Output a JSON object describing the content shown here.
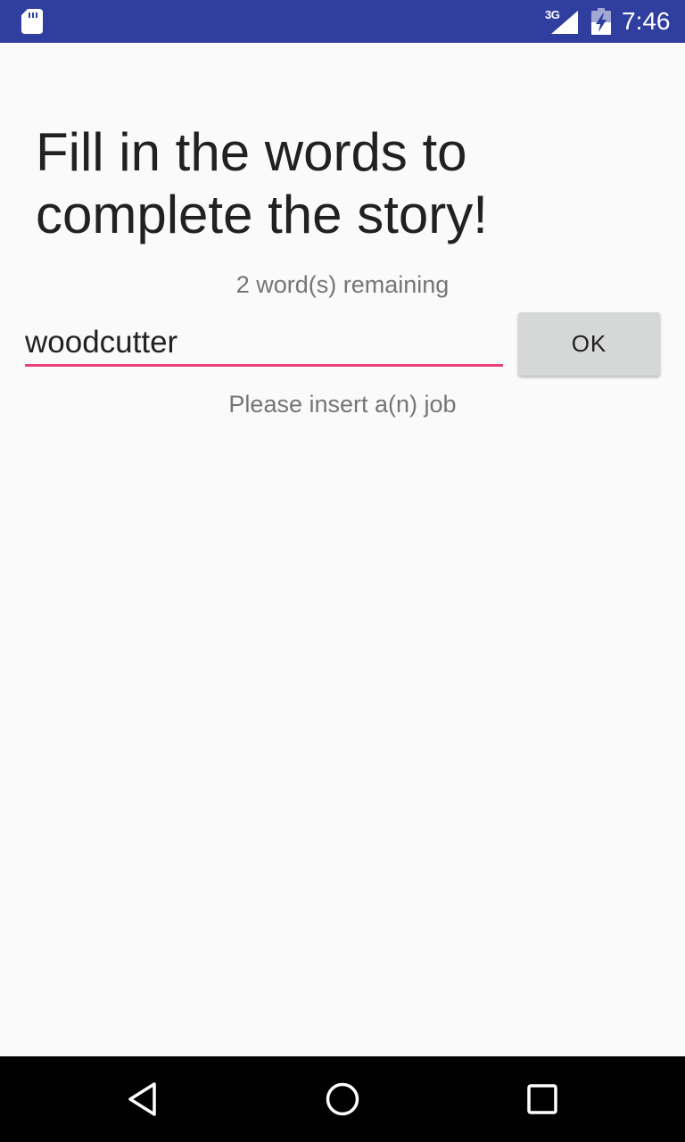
{
  "status_bar": {
    "network": "3G",
    "time": "7:46",
    "icons": [
      "sd-card-icon",
      "signal-icon",
      "battery-charging-icon"
    ],
    "bg_color": "#303f9f"
  },
  "main": {
    "title": "Fill in the words to complete the story!",
    "remaining_text": "2 word(s) remaining",
    "input_value": "woodcutter",
    "ok_label": "OK",
    "hint_text": "Please insert a(n) job",
    "accent_color": "#ec407a"
  },
  "nav_bar": {
    "icons": [
      "back-icon",
      "home-icon",
      "recents-icon"
    ]
  }
}
